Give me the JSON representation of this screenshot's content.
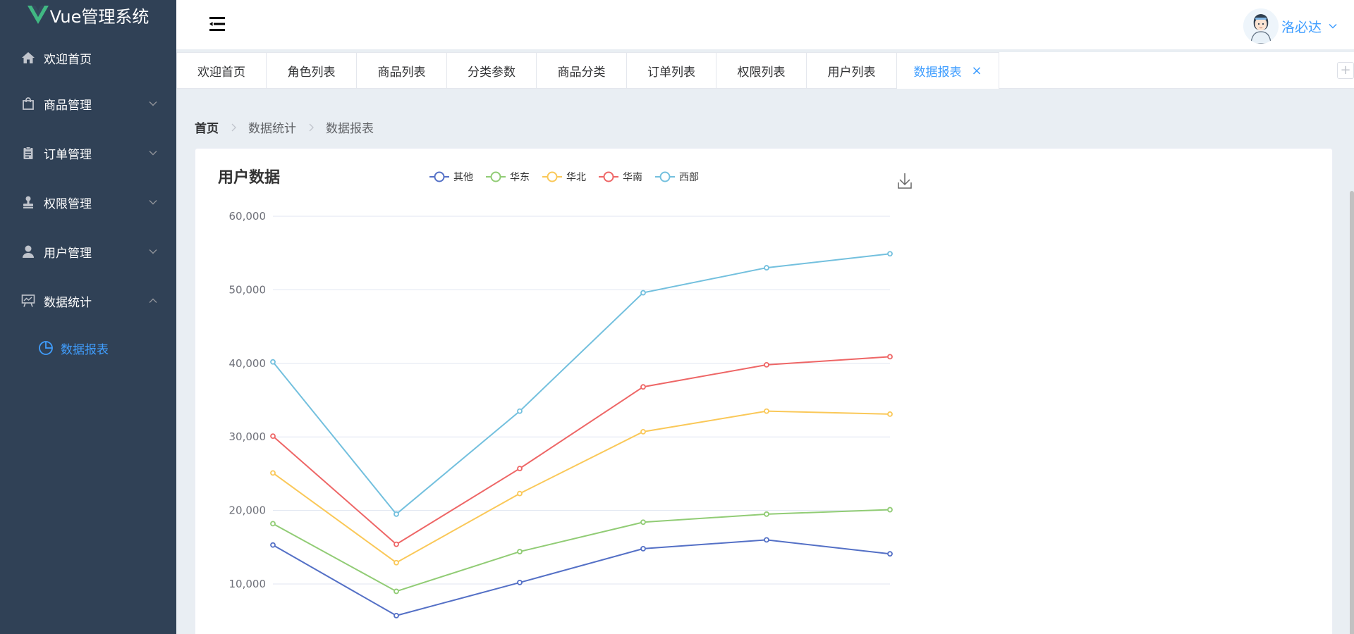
{
  "app": {
    "title": "Vue管理系统"
  },
  "sidebar": {
    "items": [
      {
        "label": "欢迎首页",
        "icon": "home-icon"
      },
      {
        "label": "商品管理",
        "icon": "shopping-bag-icon"
      },
      {
        "label": "订单管理",
        "icon": "clipboard-icon"
      },
      {
        "label": "权限管理",
        "icon": "stamp-icon"
      },
      {
        "label": "用户管理",
        "icon": "user-icon"
      },
      {
        "label": "数据统计",
        "icon": "data-board-icon"
      }
    ],
    "sub_items": [
      {
        "label": "数据报表",
        "icon": "pie-chart-icon"
      }
    ],
    "active_color": "#409eff"
  },
  "header": {
    "username": "洛必达"
  },
  "tabs": {
    "items": [
      "欢迎首页",
      "角色列表",
      "商品列表",
      "分类参数",
      "商品分类",
      "订单列表",
      "权限列表",
      "用户列表",
      "数据报表"
    ],
    "active": "数据报表",
    "close_glyph": "×",
    "add_glyph": "+"
  },
  "breadcrumb": [
    "首页",
    "数据统计",
    "数据报表"
  ],
  "chart_data": {
    "type": "line",
    "title": "用户数据",
    "x": [
      "",
      "",
      "",
      "",
      "",
      ""
    ],
    "ylim": [
      0,
      60000
    ],
    "yticks": [
      "60,000",
      "50,000",
      "40,000",
      "30,000",
      "20,000",
      "10,000"
    ],
    "grid": true,
    "legend_position": "top",
    "series": [
      {
        "name": "其他",
        "color": "#5470c6",
        "values": [
          15300,
          5700,
          10200,
          14800,
          16000,
          14100
        ]
      },
      {
        "name": "华东",
        "color": "#91cc75",
        "values": [
          18200,
          9000,
          14400,
          18400,
          19500,
          20100
        ]
      },
      {
        "name": "华北",
        "color": "#fac858",
        "values": [
          25100,
          12900,
          22300,
          30700,
          33500,
          33100
        ]
      },
      {
        "name": "华南",
        "color": "#ee6666",
        "values": [
          30100,
          15400,
          25700,
          36800,
          39800,
          40900
        ]
      },
      {
        "name": "西部",
        "color": "#73c0de",
        "values": [
          40200,
          19500,
          33500,
          49600,
          53000,
          54900
        ]
      }
    ]
  }
}
